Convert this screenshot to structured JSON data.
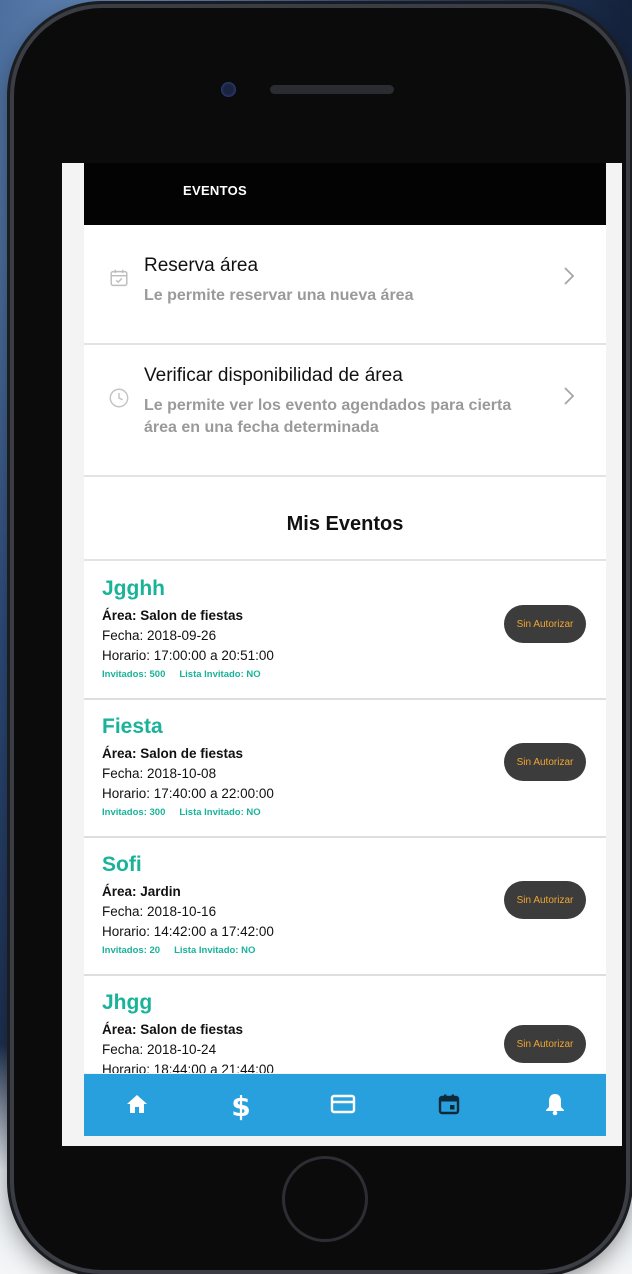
{
  "appbar": {
    "title": "EVENTOS"
  },
  "menu": [
    {
      "title": "Reserva área",
      "description": "Le permite reservar una nueva área",
      "icon": "calendar-check-icon"
    },
    {
      "title": "Verificar disponibilidad de área",
      "description": "Le permite ver los evento agendados para cierta área en una fecha determinada",
      "icon": "clock-icon"
    }
  ],
  "section_title": "Mis Eventos",
  "events": [
    {
      "name": "Jgghh",
      "area": "Área: Salon de fiestas",
      "fecha": "Fecha: 2018-09-26",
      "horario": "Horario: 17:00:00 a 20:51:00",
      "invitados": "Invitados: 500",
      "lista": "Lista Invitado: NO",
      "status": "Sin Autorizar"
    },
    {
      "name": "Fiesta",
      "area": "Área: Salon de fiestas",
      "fecha": "Fecha: 2018-10-08",
      "horario": "Horario: 17:40:00 a 22:00:00",
      "invitados": "Invitados: 300",
      "lista": "Lista Invitado: NO",
      "status": "Sin Autorizar"
    },
    {
      "name": "Sofi",
      "area": "Área: Jardin",
      "fecha": "Fecha: 2018-10-16",
      "horario": "Horario: 14:42:00 a 17:42:00",
      "invitados": "Invitados: 20",
      "lista": "Lista Invitado: NO",
      "status": "Sin Autorizar"
    },
    {
      "name": "Jhgg",
      "area": "Área: Salon de fiestas",
      "fecha": "Fecha: 2018-10-24",
      "horario": "Horario: 18:44:00 a 21:44:00",
      "invitados": "",
      "lista": "",
      "status": "Sin Autorizar"
    }
  ],
  "bottom_nav": [
    {
      "icon": "home-icon"
    },
    {
      "icon": "dollar-icon"
    },
    {
      "icon": "credit-card-icon"
    },
    {
      "icon": "calendar-icon"
    },
    {
      "icon": "bell-icon"
    }
  ],
  "colors": {
    "accent": "#19b39a",
    "nav": "#27a0dd",
    "badge_bg": "#3c3c3c",
    "badge_text": "#f0a630",
    "appbar": "#030303"
  }
}
